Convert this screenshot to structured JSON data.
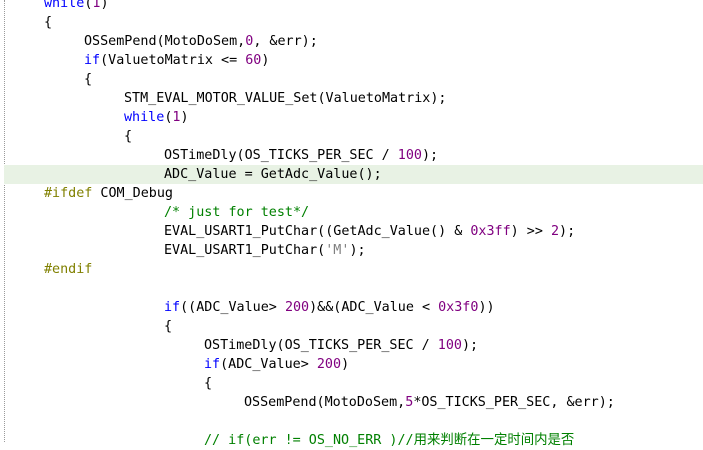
{
  "editor": {
    "current_line_index": 9,
    "lines": [
      {
        "indent": 1,
        "tokens": [
          {
            "c": "kw",
            "t": "while"
          },
          {
            "c": "op",
            "t": "("
          },
          {
            "c": "num",
            "t": "1"
          },
          {
            "c": "op",
            "t": ")"
          }
        ]
      },
      {
        "indent": 1,
        "tokens": [
          {
            "c": "op",
            "t": "{"
          }
        ]
      },
      {
        "indent": 2,
        "tokens": [
          {
            "c": "op",
            "t": "OSSemPend(MotoDoSem,"
          },
          {
            "c": "num",
            "t": "0"
          },
          {
            "c": "op",
            "t": ", &err);"
          }
        ]
      },
      {
        "indent": 2,
        "tokens": [
          {
            "c": "kw",
            "t": "if"
          },
          {
            "c": "op",
            "t": "(ValuetoMatrix <= "
          },
          {
            "c": "num",
            "t": "60"
          },
          {
            "c": "op",
            "t": ")"
          }
        ]
      },
      {
        "indent": 2,
        "tokens": [
          {
            "c": "op",
            "t": "{"
          }
        ]
      },
      {
        "indent": 3,
        "tokens": [
          {
            "c": "op",
            "t": "STM_EVAL_MOTOR_VALUE_Set(ValuetoMatrix);"
          }
        ]
      },
      {
        "indent": 3,
        "tokens": [
          {
            "c": "kw",
            "t": "while"
          },
          {
            "c": "op",
            "t": "("
          },
          {
            "c": "num",
            "t": "1"
          },
          {
            "c": "op",
            "t": ")"
          }
        ]
      },
      {
        "indent": 3,
        "tokens": [
          {
            "c": "op",
            "t": "{"
          }
        ]
      },
      {
        "indent": 4,
        "tokens": [
          {
            "c": "op",
            "t": "OSTimeDly(OS_TICKS_PER_SEC / "
          },
          {
            "c": "num",
            "t": "100"
          },
          {
            "c": "op",
            "t": ");"
          }
        ]
      },
      {
        "indent": 4,
        "tokens": [
          {
            "c": "op",
            "t": "ADC_Value = GetAdc_Value();"
          }
        ]
      },
      {
        "indent": 1,
        "tokens": [
          {
            "c": "pp",
            "t": "#ifdef"
          },
          {
            "c": "op",
            "t": " COM_Debug"
          }
        ]
      },
      {
        "indent": 4,
        "tokens": [
          {
            "c": "cm",
            "t": "/* just for test*/"
          }
        ]
      },
      {
        "indent": 4,
        "tokens": [
          {
            "c": "op",
            "t": "EVAL_USART1_PutChar((GetAdc_Value() & "
          },
          {
            "c": "num",
            "t": "0x3ff"
          },
          {
            "c": "op",
            "t": ") >> "
          },
          {
            "c": "num",
            "t": "2"
          },
          {
            "c": "op",
            "t": ");"
          }
        ]
      },
      {
        "indent": 4,
        "tokens": [
          {
            "c": "op",
            "t": "EVAL_USART1_PutChar("
          },
          {
            "c": "str",
            "t": "'M'"
          },
          {
            "c": "op",
            "t": ");"
          }
        ]
      },
      {
        "indent": 1,
        "tokens": [
          {
            "c": "pp",
            "t": "#endif"
          }
        ]
      },
      {
        "indent": 0,
        "tokens": []
      },
      {
        "indent": 4,
        "tokens": [
          {
            "c": "kw",
            "t": "if"
          },
          {
            "c": "op",
            "t": "((ADC_Value> "
          },
          {
            "c": "num",
            "t": "200"
          },
          {
            "c": "op",
            "t": ")&&(ADC_Value < "
          },
          {
            "c": "num",
            "t": "0x3f0"
          },
          {
            "c": "op",
            "t": "))"
          }
        ]
      },
      {
        "indent": 4,
        "tokens": [
          {
            "c": "op",
            "t": "{"
          }
        ]
      },
      {
        "indent": 5,
        "tokens": [
          {
            "c": "op",
            "t": "OSTimeDly(OS_TICKS_PER_SEC / "
          },
          {
            "c": "num",
            "t": "100"
          },
          {
            "c": "op",
            "t": ");"
          }
        ]
      },
      {
        "indent": 5,
        "tokens": [
          {
            "c": "kw",
            "t": "if"
          },
          {
            "c": "op",
            "t": "(ADC_Value> "
          },
          {
            "c": "num",
            "t": "200"
          },
          {
            "c": "op",
            "t": ")"
          }
        ]
      },
      {
        "indent": 5,
        "tokens": [
          {
            "c": "op",
            "t": "{"
          }
        ]
      },
      {
        "indent": 6,
        "tokens": [
          {
            "c": "op",
            "t": "OSSemPend(MotoDoSem,"
          },
          {
            "c": "num",
            "t": "5"
          },
          {
            "c": "op",
            "t": "*OS_TICKS_PER_SEC, &err);"
          }
        ]
      },
      {
        "indent": 0,
        "tokens": []
      },
      {
        "indent": 5,
        "tokens": [
          {
            "c": "cm",
            "t": "// if(err != OS_NO_ERR )//用来判断在一定时间内是否"
          }
        ]
      }
    ]
  }
}
